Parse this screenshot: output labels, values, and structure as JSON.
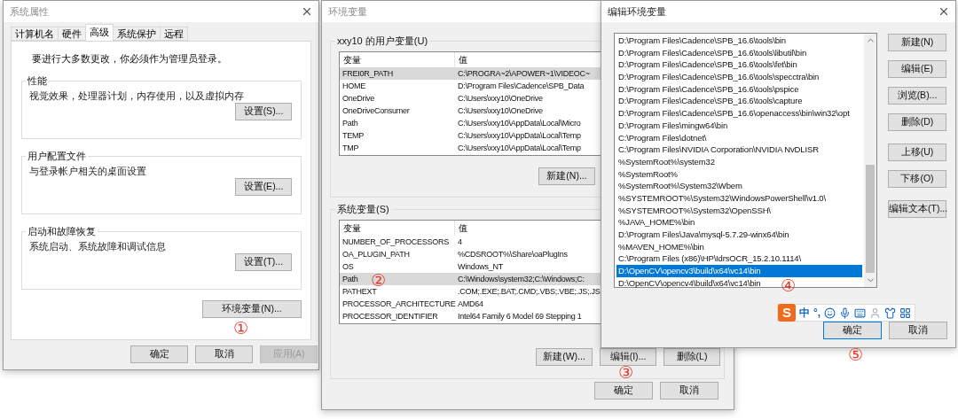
{
  "system_properties": {
    "title": "系统属性",
    "tabs": [
      {
        "label": "计算机名",
        "selected": false
      },
      {
        "label": "硬件",
        "selected": false
      },
      {
        "label": "高级",
        "selected": true
      },
      {
        "label": "系统保护",
        "selected": false
      },
      {
        "label": "远程",
        "selected": false
      }
    ],
    "notice": "要进行大多数更改，你必须作为管理员登录。",
    "groups": [
      {
        "label": "性能",
        "description": "视觉效果，处理器计划，内存使用，以及虚拟内存",
        "button": "设置(S)..."
      },
      {
        "label": "用户配置文件",
        "description": "与登录帐户相关的桌面设置",
        "button": "设置(E)..."
      },
      {
        "label": "启动和故障恢复",
        "description": "系统启动、系统故障和调试信息",
        "button": "设置(T)..."
      }
    ],
    "env_button": "环境变量(N)...",
    "footer_buttons": [
      {
        "label": "确定",
        "disabled": false
      },
      {
        "label": "取消",
        "disabled": false
      },
      {
        "label": "应用(A)",
        "disabled": true
      }
    ]
  },
  "environment_variables": {
    "title": "环境变量",
    "user_group": {
      "label": "xxy10 的用户变量(U)",
      "columns": [
        "变量",
        "值"
      ],
      "rows": [
        {
          "name": "FREI0R_PATH",
          "value": "C:\\PROGRA~2\\APOWER~1\\VIDEOC~",
          "selected": true
        },
        {
          "name": "HOME",
          "value": "D:\\Program Files\\Cadence\\SPB_Data",
          "selected": false
        },
        {
          "name": "OneDrive",
          "value": "C:\\Users\\xxy10\\OneDrive",
          "selected": false
        },
        {
          "name": "OneDriveConsumer",
          "value": "C:\\Users\\xxy10\\OneDrive",
          "selected": false
        },
        {
          "name": "Path",
          "value": "C:\\Users\\xxy10\\AppData\\Local\\Micro",
          "selected": false
        },
        {
          "name": "TEMP",
          "value": "C:\\Users\\xxy10\\AppData\\Local\\Temp",
          "selected": false
        },
        {
          "name": "TMP",
          "value": "C:\\Users\\xxy10\\AppData\\Local\\Temp",
          "selected": false
        }
      ],
      "buttons": [
        "新建(N)..."
      ]
    },
    "system_group": {
      "label": "系统变量(S)",
      "columns": [
        "变量",
        "值"
      ],
      "rows": [
        {
          "name": "NUMBER_OF_PROCESSORS",
          "value": "4",
          "selected": false
        },
        {
          "name": "OA_PLUGIN_PATH",
          "value": "%CDSROOT%\\Share\\oaPlugIns",
          "selected": false
        },
        {
          "name": "OS",
          "value": "Windows_NT",
          "selected": false
        },
        {
          "name": "Path",
          "value": "C:\\Windows\\system32;C:\\Windows;C:",
          "selected": true
        },
        {
          "name": "PATHEXT",
          "value": ".COM;.EXE;.BAT;.CMD;.VBS;.VBE;.JS;.JS",
          "selected": false
        },
        {
          "name": "PROCESSOR_ARCHITECTURE",
          "value": "AMD64",
          "selected": false
        },
        {
          "name": "PROCESSOR_IDENTIFIER",
          "value": "Intel64 Family 6 Model 69 Stepping 1",
          "selected": false
        }
      ],
      "buttons": [
        "新建(W)...",
        "编辑(I)...",
        "删除(L)"
      ]
    },
    "footer_buttons": [
      "确定",
      "取消"
    ]
  },
  "edit_environment_variable": {
    "title": "编辑环境变量",
    "paths": [
      {
        "text": "D:\\Program Files\\Cadence\\SPB_16.6\\tools\\bin",
        "selected": false
      },
      {
        "text": "D:\\Program Files\\Cadence\\SPB_16.6\\tools\\libutil\\bin",
        "selected": false
      },
      {
        "text": "D:\\Program Files\\Cadence\\SPB_16.6\\tools\\fet\\bin",
        "selected": false
      },
      {
        "text": "D:\\Program Files\\Cadence\\SPB_16.6\\tools\\specctra\\bin",
        "selected": false
      },
      {
        "text": "D:\\Program Files\\Cadence\\SPB_16.6\\tools\\pspice",
        "selected": false
      },
      {
        "text": "D:\\Program Files\\Cadence\\SPB_16.6\\tools\\capture",
        "selected": false
      },
      {
        "text": "D:\\Program Files\\Cadence\\SPB_16.6\\openaccess\\bin\\win32\\opt",
        "selected": false
      },
      {
        "text": "D:\\Program Files\\mingw64\\bin",
        "selected": false
      },
      {
        "text": "C:\\Program Files\\dotnet\\",
        "selected": false
      },
      {
        "text": "C:\\Program Files\\NVIDIA Corporation\\NVIDIA NvDLISR",
        "selected": false
      },
      {
        "text": "%SystemRoot%\\system32",
        "selected": false
      },
      {
        "text": "%SystemRoot%",
        "selected": false
      },
      {
        "text": "%SystemRoot%\\System32\\Wbem",
        "selected": false
      },
      {
        "text": "%SYSTEMROOT%\\System32\\WindowsPowerShell\\v1.0\\",
        "selected": false
      },
      {
        "text": "%SYSTEMROOT%\\System32\\OpenSSH\\",
        "selected": false
      },
      {
        "text": "%JAVA_HOME%\\bin",
        "selected": false
      },
      {
        "text": "D:\\Program Files\\Java\\mysql-5.7.29-winx64\\bin",
        "selected": false
      },
      {
        "text": "%MAVEN_HOME%\\bin",
        "selected": false
      },
      {
        "text": "C:\\Program Files (x86)\\HP\\IdrsOCR_15.2.10.1114\\",
        "selected": false
      },
      {
        "text": "D:\\OpenCV\\opencv3\\build\\x64\\vc14\\bin",
        "selected": true
      },
      {
        "text": "D:\\OpenCV\\opencv4\\build\\x64\\vc14\\bin",
        "selected": false
      }
    ],
    "button_groups": [
      [
        "新建(N)",
        "编辑(E)",
        "浏览(B)...",
        "删除(D)"
      ],
      [
        "上移(U)",
        "下移(O)"
      ],
      [
        "编辑文本(T)..."
      ]
    ],
    "footer_buttons": [
      {
        "label": "确定",
        "focused": true
      },
      {
        "label": "取消",
        "focused": false
      }
    ]
  },
  "ime_toolbar": {
    "logo": "S",
    "mode": "中",
    "punctuation": "°,"
  },
  "annotations": [
    {
      "text": "①"
    },
    {
      "text": "②"
    },
    {
      "text": "③"
    },
    {
      "text": "④"
    },
    {
      "text": "⑤"
    }
  ]
}
